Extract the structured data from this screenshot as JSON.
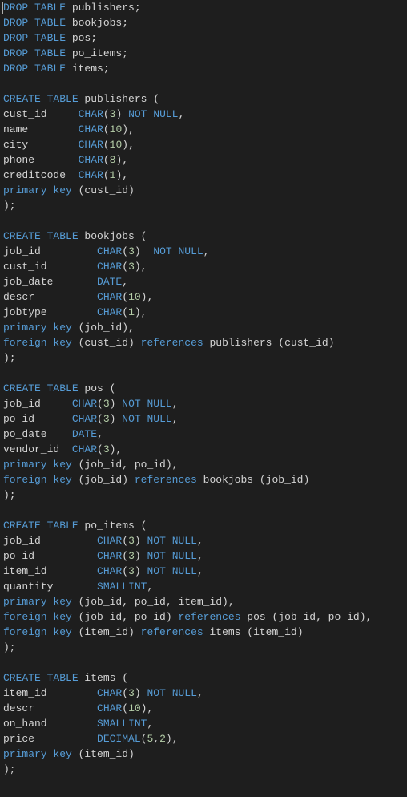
{
  "code": {
    "lines": [
      [
        {
          "t": "DROP TABLE",
          "c": "kw-blue"
        },
        {
          "t": " publishers;",
          "c": "plain"
        }
      ],
      [
        {
          "t": "DROP TABLE",
          "c": "kw-blue"
        },
        {
          "t": " bookjobs;",
          "c": "plain"
        }
      ],
      [
        {
          "t": "DROP TABLE",
          "c": "kw-blue"
        },
        {
          "t": " pos;",
          "c": "plain"
        }
      ],
      [
        {
          "t": "DROP TABLE",
          "c": "kw-blue"
        },
        {
          "t": " po_items;",
          "c": "plain"
        }
      ],
      [
        {
          "t": "DROP TABLE",
          "c": "kw-blue"
        },
        {
          "t": " items;",
          "c": "plain"
        }
      ],
      [],
      [
        {
          "t": "CREATE TABLE",
          "c": "kw-blue"
        },
        {
          "t": " publishers (",
          "c": "plain"
        }
      ],
      [
        {
          "t": "cust_id     ",
          "c": "plain"
        },
        {
          "t": "CHAR",
          "c": "kw-type"
        },
        {
          "t": "(",
          "c": "paren"
        },
        {
          "t": "3",
          "c": "num"
        },
        {
          "t": ") ",
          "c": "paren"
        },
        {
          "t": "NOT NULL",
          "c": "kw-blue"
        },
        {
          "t": ",",
          "c": "plain"
        }
      ],
      [
        {
          "t": "name        ",
          "c": "plain"
        },
        {
          "t": "CHAR",
          "c": "kw-type"
        },
        {
          "t": "(",
          "c": "paren"
        },
        {
          "t": "10",
          "c": "num"
        },
        {
          "t": "),",
          "c": "plain"
        }
      ],
      [
        {
          "t": "city        ",
          "c": "plain"
        },
        {
          "t": "CHAR",
          "c": "kw-type"
        },
        {
          "t": "(",
          "c": "paren"
        },
        {
          "t": "10",
          "c": "num"
        },
        {
          "t": "),",
          "c": "plain"
        }
      ],
      [
        {
          "t": "phone       ",
          "c": "plain"
        },
        {
          "t": "CHAR",
          "c": "kw-type"
        },
        {
          "t": "(",
          "c": "paren"
        },
        {
          "t": "8",
          "c": "num"
        },
        {
          "t": "),",
          "c": "plain"
        }
      ],
      [
        {
          "t": "creditcode  ",
          "c": "plain"
        },
        {
          "t": "CHAR",
          "c": "kw-type"
        },
        {
          "t": "(",
          "c": "paren"
        },
        {
          "t": "1",
          "c": "num"
        },
        {
          "t": "),",
          "c": "plain"
        }
      ],
      [
        {
          "t": "primary key",
          "c": "kw-blue"
        },
        {
          "t": " (cust_id)",
          "c": "plain"
        }
      ],
      [
        {
          "t": ");",
          "c": "plain"
        }
      ],
      [],
      [
        {
          "t": "CREATE TABLE",
          "c": "kw-blue"
        },
        {
          "t": " bookjobs (",
          "c": "plain"
        }
      ],
      [
        {
          "t": "job_id         ",
          "c": "plain"
        },
        {
          "t": "CHAR",
          "c": "kw-type"
        },
        {
          "t": "(",
          "c": "paren"
        },
        {
          "t": "3",
          "c": "num"
        },
        {
          "t": ")  ",
          "c": "paren"
        },
        {
          "t": "NOT NULL",
          "c": "kw-blue"
        },
        {
          "t": ",",
          "c": "plain"
        }
      ],
      [
        {
          "t": "cust_id        ",
          "c": "plain"
        },
        {
          "t": "CHAR",
          "c": "kw-type"
        },
        {
          "t": "(",
          "c": "paren"
        },
        {
          "t": "3",
          "c": "num"
        },
        {
          "t": "),",
          "c": "plain"
        }
      ],
      [
        {
          "t": "job_date       ",
          "c": "plain"
        },
        {
          "t": "DATE",
          "c": "kw-type"
        },
        {
          "t": ",",
          "c": "plain"
        }
      ],
      [
        {
          "t": "descr          ",
          "c": "plain"
        },
        {
          "t": "CHAR",
          "c": "kw-type"
        },
        {
          "t": "(",
          "c": "paren"
        },
        {
          "t": "10",
          "c": "num"
        },
        {
          "t": "),",
          "c": "plain"
        }
      ],
      [
        {
          "t": "jobtype        ",
          "c": "plain"
        },
        {
          "t": "CHAR",
          "c": "kw-type"
        },
        {
          "t": "(",
          "c": "paren"
        },
        {
          "t": "1",
          "c": "num"
        },
        {
          "t": "),",
          "c": "plain"
        }
      ],
      [
        {
          "t": "primary key",
          "c": "kw-blue"
        },
        {
          "t": " (job_id),",
          "c": "plain"
        }
      ],
      [
        {
          "t": "foreign key",
          "c": "kw-blue"
        },
        {
          "t": " (cust_id) ",
          "c": "plain"
        },
        {
          "t": "references",
          "c": "kw-blue"
        },
        {
          "t": " publishers (cust_id)",
          "c": "plain"
        }
      ],
      [
        {
          "t": ");",
          "c": "plain"
        }
      ],
      [],
      [
        {
          "t": "CREATE TABLE",
          "c": "kw-blue"
        },
        {
          "t": " pos (",
          "c": "plain"
        }
      ],
      [
        {
          "t": "job_id     ",
          "c": "plain"
        },
        {
          "t": "CHAR",
          "c": "kw-type"
        },
        {
          "t": "(",
          "c": "paren"
        },
        {
          "t": "3",
          "c": "num"
        },
        {
          "t": ") ",
          "c": "paren"
        },
        {
          "t": "NOT NULL",
          "c": "kw-blue"
        },
        {
          "t": ",",
          "c": "plain"
        }
      ],
      [
        {
          "t": "po_id      ",
          "c": "plain"
        },
        {
          "t": "CHAR",
          "c": "kw-type"
        },
        {
          "t": "(",
          "c": "paren"
        },
        {
          "t": "3",
          "c": "num"
        },
        {
          "t": ") ",
          "c": "paren"
        },
        {
          "t": "NOT NULL",
          "c": "kw-blue"
        },
        {
          "t": ",",
          "c": "plain"
        }
      ],
      [
        {
          "t": "po_date    ",
          "c": "plain"
        },
        {
          "t": "DATE",
          "c": "kw-type"
        },
        {
          "t": ",",
          "c": "plain"
        }
      ],
      [
        {
          "t": "vendor_id  ",
          "c": "plain"
        },
        {
          "t": "CHAR",
          "c": "kw-type"
        },
        {
          "t": "(",
          "c": "paren"
        },
        {
          "t": "3",
          "c": "num"
        },
        {
          "t": "),",
          "c": "plain"
        }
      ],
      [
        {
          "t": "primary key",
          "c": "kw-blue"
        },
        {
          "t": " (job_id, po_id),",
          "c": "plain"
        }
      ],
      [
        {
          "t": "foreign key",
          "c": "kw-blue"
        },
        {
          "t": " (job_id) ",
          "c": "plain"
        },
        {
          "t": "references",
          "c": "kw-blue"
        },
        {
          "t": " bookjobs (job_id)",
          "c": "plain"
        }
      ],
      [
        {
          "t": ");",
          "c": "plain"
        }
      ],
      [],
      [
        {
          "t": "CREATE TABLE",
          "c": "kw-blue"
        },
        {
          "t": " po_items (",
          "c": "plain"
        }
      ],
      [
        {
          "t": "job_id         ",
          "c": "plain"
        },
        {
          "t": "CHAR",
          "c": "kw-type"
        },
        {
          "t": "(",
          "c": "paren"
        },
        {
          "t": "3",
          "c": "num"
        },
        {
          "t": ") ",
          "c": "paren"
        },
        {
          "t": "NOT NULL",
          "c": "kw-blue"
        },
        {
          "t": ",",
          "c": "plain"
        }
      ],
      [
        {
          "t": "po_id          ",
          "c": "plain"
        },
        {
          "t": "CHAR",
          "c": "kw-type"
        },
        {
          "t": "(",
          "c": "paren"
        },
        {
          "t": "3",
          "c": "num"
        },
        {
          "t": ") ",
          "c": "paren"
        },
        {
          "t": "NOT NULL",
          "c": "kw-blue"
        },
        {
          "t": ",",
          "c": "plain"
        }
      ],
      [
        {
          "t": "item_id        ",
          "c": "plain"
        },
        {
          "t": "CHAR",
          "c": "kw-type"
        },
        {
          "t": "(",
          "c": "paren"
        },
        {
          "t": "3",
          "c": "num"
        },
        {
          "t": ") ",
          "c": "paren"
        },
        {
          "t": "NOT NULL",
          "c": "kw-blue"
        },
        {
          "t": ",",
          "c": "plain"
        }
      ],
      [
        {
          "t": "quantity       ",
          "c": "plain"
        },
        {
          "t": "SMALLINT",
          "c": "kw-type"
        },
        {
          "t": ",",
          "c": "plain"
        }
      ],
      [
        {
          "t": "primary key",
          "c": "kw-blue"
        },
        {
          "t": " (job_id, po_id, item_id),",
          "c": "plain"
        }
      ],
      [
        {
          "t": "foreign key",
          "c": "kw-blue"
        },
        {
          "t": " (job_id, po_id) ",
          "c": "plain"
        },
        {
          "t": "references",
          "c": "kw-blue"
        },
        {
          "t": " pos (job_id, po_id),",
          "c": "plain"
        }
      ],
      [
        {
          "t": "foreign key",
          "c": "kw-blue"
        },
        {
          "t": " (item_id) ",
          "c": "plain"
        },
        {
          "t": "references",
          "c": "kw-blue"
        },
        {
          "t": " items (item_id)",
          "c": "plain"
        }
      ],
      [
        {
          "t": ");",
          "c": "plain"
        }
      ],
      [],
      [
        {
          "t": "CREATE TABLE",
          "c": "kw-blue"
        },
        {
          "t": " items (",
          "c": "plain"
        }
      ],
      [
        {
          "t": "item_id        ",
          "c": "plain"
        },
        {
          "t": "CHAR",
          "c": "kw-type"
        },
        {
          "t": "(",
          "c": "paren"
        },
        {
          "t": "3",
          "c": "num"
        },
        {
          "t": ") ",
          "c": "paren"
        },
        {
          "t": "NOT NULL",
          "c": "kw-blue"
        },
        {
          "t": ",",
          "c": "plain"
        }
      ],
      [
        {
          "t": "descr          ",
          "c": "plain"
        },
        {
          "t": "CHAR",
          "c": "kw-type"
        },
        {
          "t": "(",
          "c": "paren"
        },
        {
          "t": "10",
          "c": "num"
        },
        {
          "t": "),",
          "c": "plain"
        }
      ],
      [
        {
          "t": "on_hand        ",
          "c": "plain"
        },
        {
          "t": "SMALLINT",
          "c": "kw-type"
        },
        {
          "t": ",",
          "c": "plain"
        }
      ],
      [
        {
          "t": "price          ",
          "c": "plain"
        },
        {
          "t": "DECIMAL",
          "c": "kw-type"
        },
        {
          "t": "(",
          "c": "paren"
        },
        {
          "t": "5",
          "c": "num"
        },
        {
          "t": ",",
          "c": "plain"
        },
        {
          "t": "2",
          "c": "num"
        },
        {
          "t": "),",
          "c": "plain"
        }
      ],
      [
        {
          "t": "primary key",
          "c": "kw-blue"
        },
        {
          "t": " (item_id)",
          "c": "plain"
        }
      ],
      [
        {
          "t": ");",
          "c": "plain"
        }
      ]
    ],
    "cursor_line": 0
  }
}
